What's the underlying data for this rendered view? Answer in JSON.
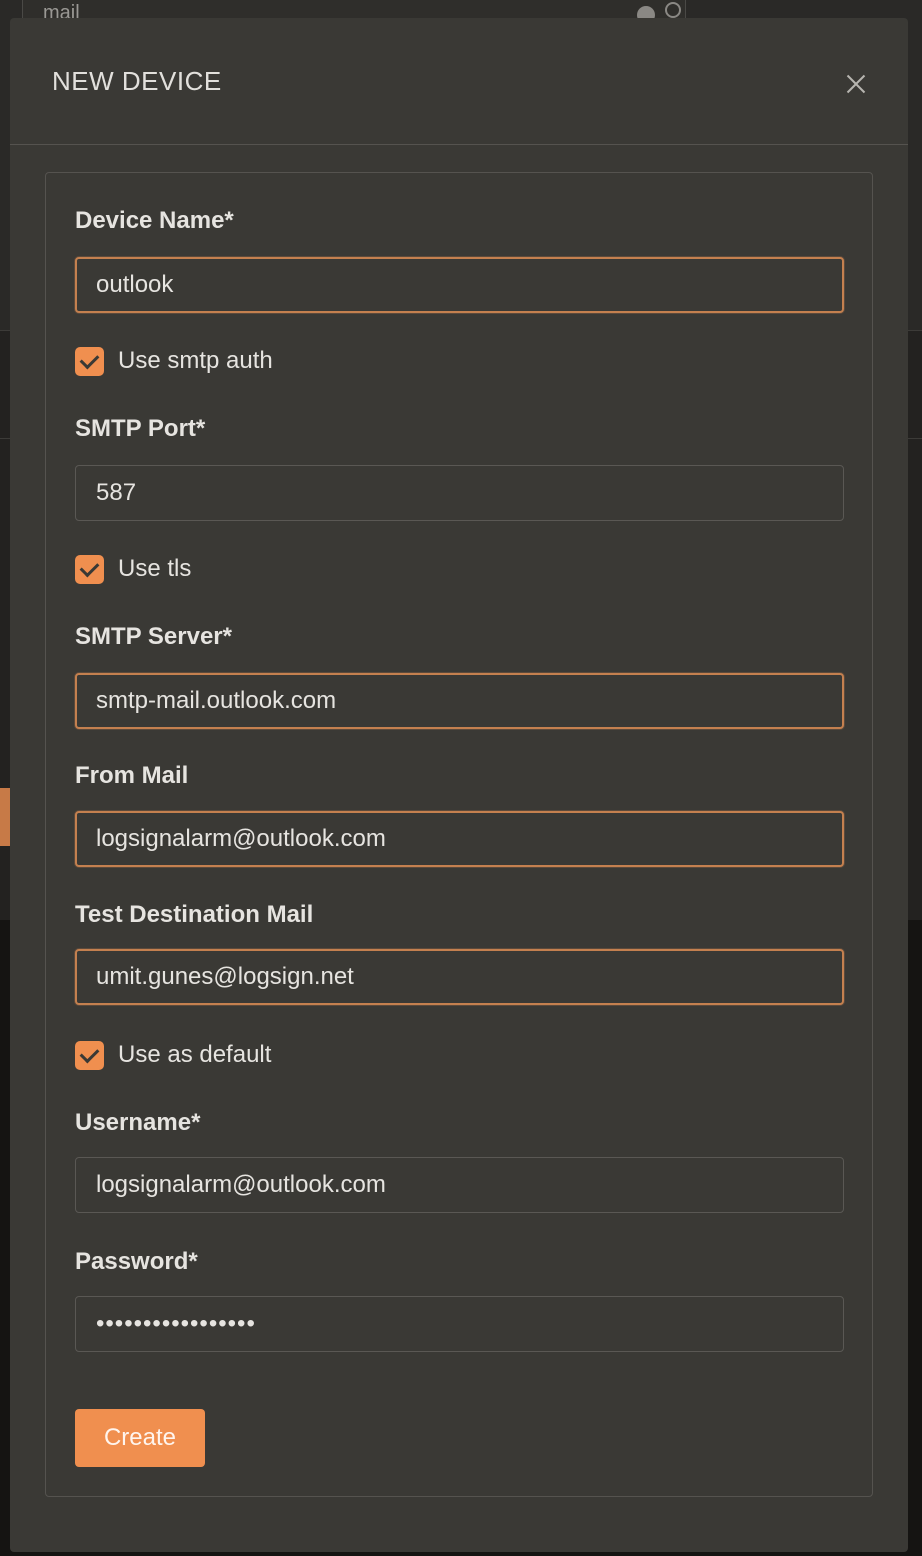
{
  "background": {
    "search_value": "mail"
  },
  "modal": {
    "title": "NEW DEVICE",
    "close_icon": "close-icon"
  },
  "form": {
    "device_name": {
      "label": "Device Name*",
      "value": "outlook"
    },
    "use_smtp_auth": {
      "label": "Use smtp auth",
      "checked": true
    },
    "smtp_port": {
      "label": "SMTP Port*",
      "value": "587"
    },
    "use_tls": {
      "label": "Use tls",
      "checked": true
    },
    "smtp_server": {
      "label": "SMTP Server*",
      "value": "smtp-mail.outlook.com"
    },
    "from_mail": {
      "label": "From Mail",
      "value": "logsignalarm@outlook.com"
    },
    "test_destination_mail": {
      "label": "Test Destination Mail",
      "value": "umit.gunes@logsign.net"
    },
    "use_as_default": {
      "label": "Use as default",
      "checked": true
    },
    "username": {
      "label": "Username*",
      "value": "logsignalarm@outlook.com"
    },
    "password": {
      "label": "Password*",
      "value": "•••••••••••••••••"
    },
    "create_label": "Create"
  },
  "colors": {
    "accent": "#f08f4f",
    "focus_border": "#c4804f",
    "modal_bg": "#3a3935"
  }
}
